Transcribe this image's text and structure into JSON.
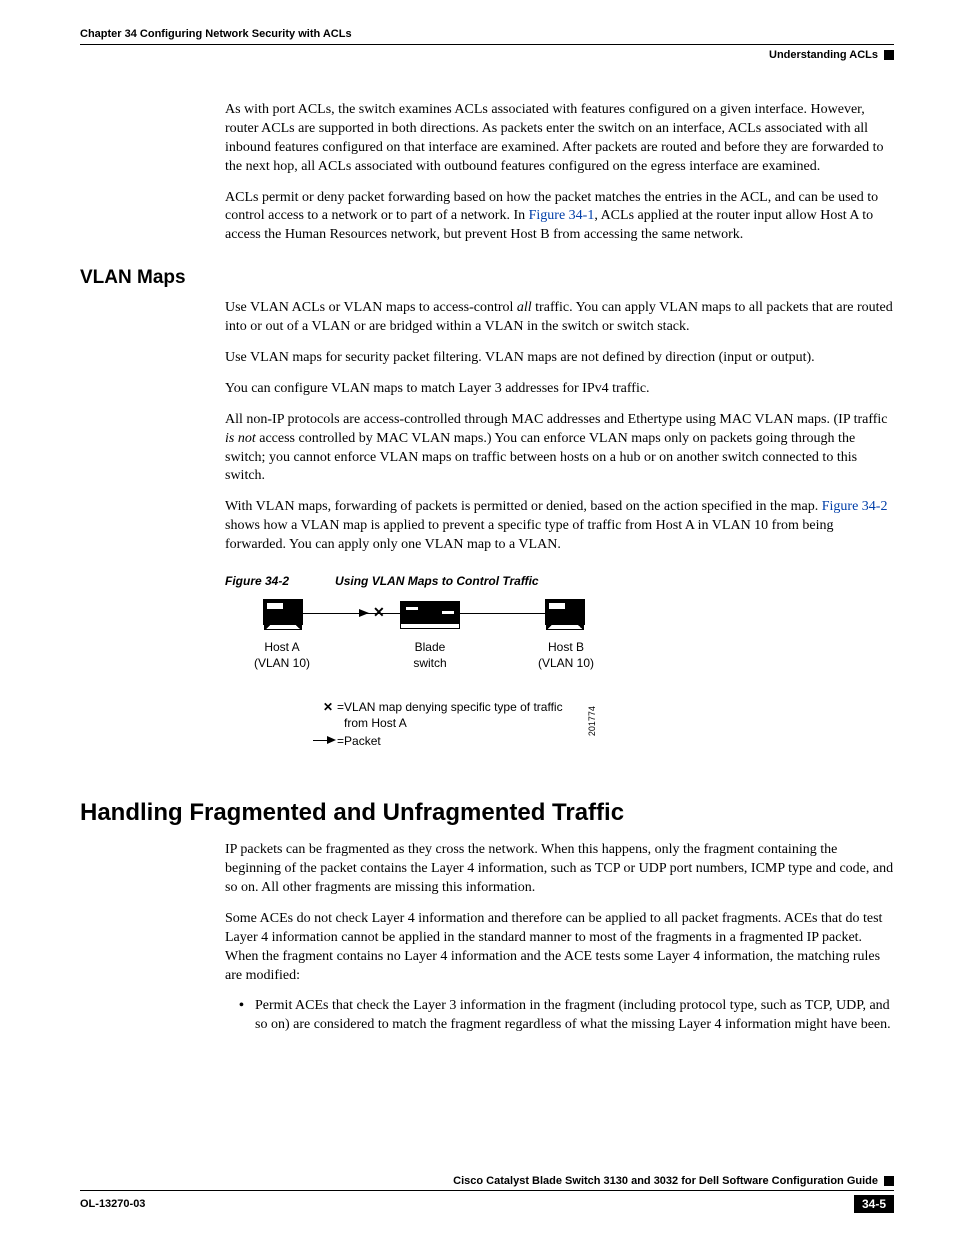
{
  "header": {
    "chapter": "Chapter 34    Configuring Network Security with ACLs",
    "section": "Understanding ACLs"
  },
  "intro": {
    "p1": "As with port ACLs, the switch examines ACLs associated with features configured on a given interface. However, router ACLs are supported in both directions. As packets enter the switch on an interface, ACLs associated with all inbound features configured on that interface are examined. After packets are routed and before they are forwarded to the next hop, all ACLs associated with outbound features configured on the egress interface are examined.",
    "p2a": "ACLs permit or deny packet forwarding based on how the packet matches the entries in the ACL, and can be used to control access to a network or to part of a network. In ",
    "p2_link": "Figure 34-1",
    "p2b": ", ACLs applied at the router input allow Host A to access the Human Resources network, but prevent Host B from accessing the same network."
  },
  "vlan": {
    "heading": "VLAN Maps",
    "p1a": "Use VLAN ACLs or VLAN maps to access-control ",
    "p1_em": "all",
    "p1b": " traffic. You can apply VLAN maps to all packets that are routed into or out of a VLAN or are bridged within a VLAN in the switch or switch stack.",
    "p2": "Use VLAN maps for security packet filtering. VLAN maps are not defined by direction (input or output).",
    "p3": "You can configure VLAN maps to match Layer 3 addresses for IPv4 traffic.",
    "p4a": "All non-IP protocols are access-controlled through MAC addresses and Ethertype using MAC VLAN maps. (IP traffic ",
    "p4_em": "is not",
    "p4b": " access controlled by MAC VLAN maps.) You can enforce VLAN maps only on packets going through the switch; you cannot enforce VLAN maps on traffic between hosts on a hub or on another switch connected to this switch.",
    "p5a": "With VLAN maps, forwarding of packets is permitted or denied, based on the action specified in the map. ",
    "p5_link": "Figure 34-2",
    "p5b": " shows how a VLAN map is applied to prevent a specific type of traffic from Host A in VLAN 10 from being forwarded. You can apply only one VLAN map to a VLAN."
  },
  "figure": {
    "caption_num": "Figure 34-2",
    "caption_title": "Using VLAN Maps to Control Traffic",
    "hostA_l1": "Host A",
    "hostA_l2": "(VLAN 10)",
    "switch_l1": "Blade",
    "switch_l2": "switch",
    "hostB_l1": "Host B",
    "hostB_l2": "(VLAN 10)",
    "legend_x_sym": "✕",
    "legend_x_eq": " =  ",
    "legend_x_txt": "VLAN map denying specific type of traffic from Host A",
    "legend_arrow_eq": " =  ",
    "legend_arrow_txt": "Packet",
    "fignum": "201774"
  },
  "frag": {
    "heading": "Handling Fragmented and Unfragmented Traffic",
    "p1": "IP packets can be fragmented as they cross the network. When this happens, only the fragment containing the beginning of the packet contains the Layer 4 information, such as TCP or UDP port numbers, ICMP type and code, and so on. All other fragments are missing this information.",
    "p2": "Some ACEs do not check Layer 4 information and therefore can be applied to all packet fragments. ACEs that do test Layer 4 information cannot be applied in the standard manner to most of the fragments in a fragmented IP packet. When the fragment contains no Layer 4 information and the ACE tests some Layer 4 information, the matching rules are modified:",
    "bullet1": "Permit ACEs that check the Layer 3 information in the fragment (including protocol type, such as TCP, UDP, and so on) are considered to match the fragment regardless of what the missing Layer 4 information might have been."
  },
  "footer": {
    "guide": "Cisco Catalyst Blade Switch 3130 and 3032 for Dell Software Configuration Guide",
    "docid": "OL-13270-03",
    "pagenum": "34-5"
  }
}
